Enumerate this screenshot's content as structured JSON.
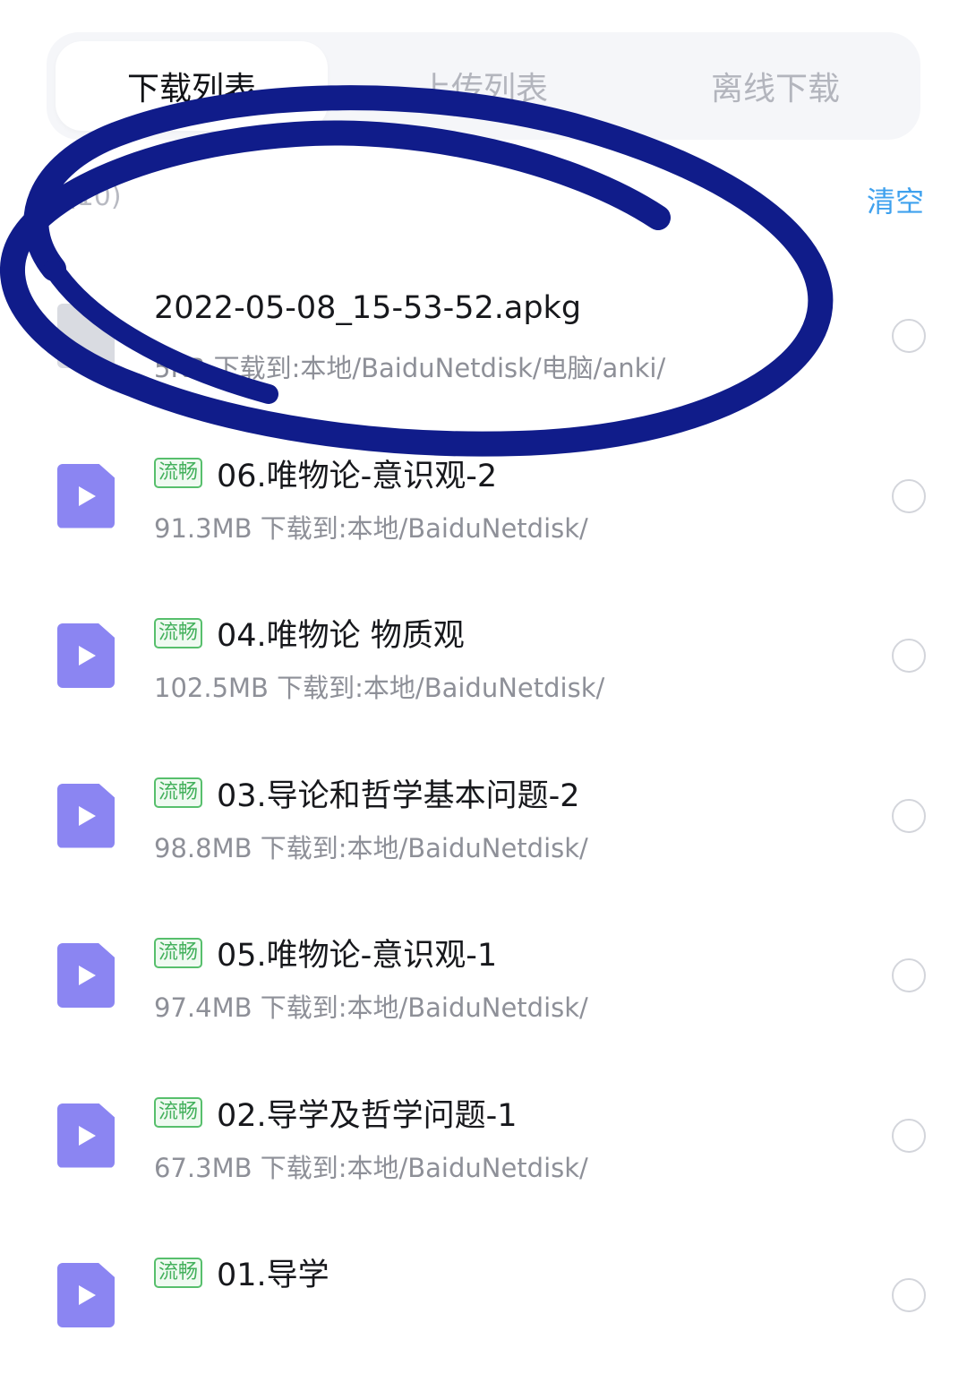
{
  "tabs": [
    {
      "label": "下载列表",
      "active": true
    },
    {
      "label": "上传列表",
      "active": false
    },
    {
      "label": "离线下载",
      "active": false
    }
  ],
  "section": {
    "count_label": "(10)",
    "clear_label": "清空"
  },
  "badge_label": "流畅",
  "items": [
    {
      "title": "2022-05-08_15-53-52.apkg",
      "meta": "5KB 下载到:本地/BaiduNetdisk/电脑/anki/",
      "badge": false,
      "icon": "generic-file-icon"
    },
    {
      "title": "06.唯物论-意识观-2",
      "meta": "91.3MB 下载到:本地/BaiduNetdisk/",
      "badge": true,
      "icon": "video-file-icon"
    },
    {
      "title": "04.唯物论 物质观",
      "meta": "102.5MB 下载到:本地/BaiduNetdisk/",
      "badge": true,
      "icon": "video-file-icon"
    },
    {
      "title": "03.导论和哲学基本问题-2",
      "meta": "98.8MB 下载到:本地/BaiduNetdisk/",
      "badge": true,
      "icon": "video-file-icon"
    },
    {
      "title": "05.唯物论-意识观-1",
      "meta": "97.4MB 下载到:本地/BaiduNetdisk/",
      "badge": true,
      "icon": "video-file-icon"
    },
    {
      "title": "02.导学及哲学问题-1",
      "meta": "67.3MB 下载到:本地/BaiduNetdisk/",
      "badge": true,
      "icon": "video-file-icon"
    },
    {
      "title": "01.导学",
      "meta": "",
      "badge": true,
      "icon": "video-file-icon"
    }
  ],
  "colors": {
    "accent": "#3fa1ee",
    "video_icon": "#8b85f2",
    "badge_green": "#43b05c",
    "scribble": "#101c8a"
  }
}
